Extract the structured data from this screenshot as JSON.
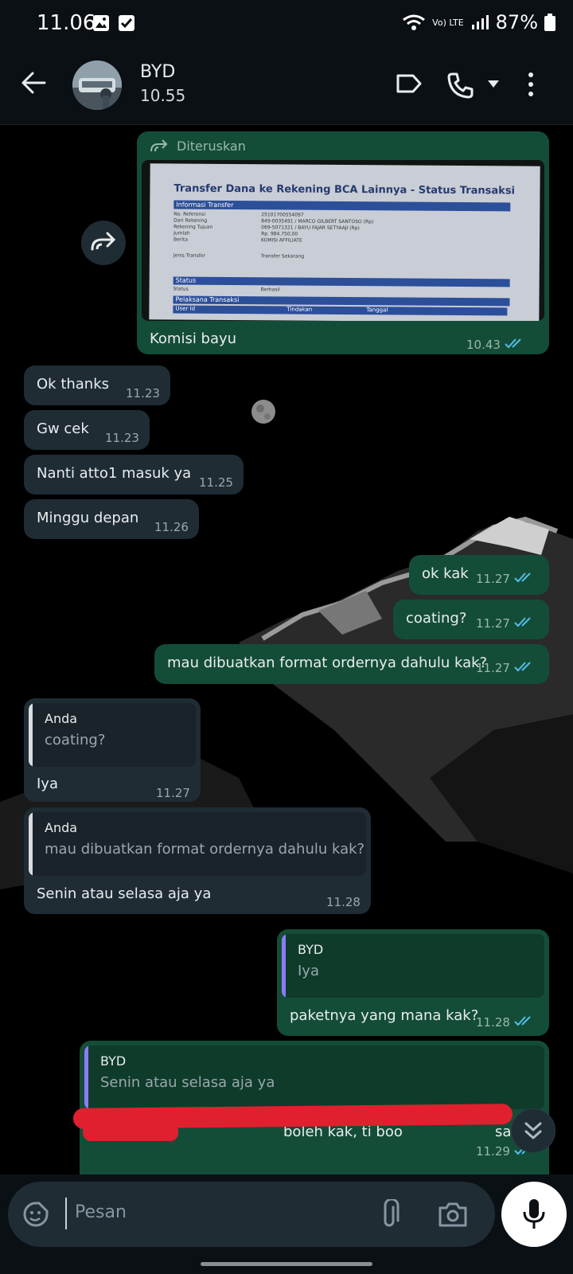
{
  "status_bar": {
    "time": "11.06",
    "battery": "87%",
    "network": "Vo) LTE"
  },
  "header": {
    "name": "BYD",
    "subtitle": "10.55"
  },
  "messages": {
    "forwarded": {
      "label": "Diteruskan",
      "caption": "Komisi bayu",
      "time": "10.43",
      "doc_title": "Transfer Dana ke Rekening BCA Lainnya - Status Transaksi",
      "doc_section1": "Informasi Transfer",
      "doc_rows": [
        {
          "k": "No. Referensi",
          "v": "25101700554097"
        },
        {
          "k": "Dari Rekening",
          "v": "849-0035491 / MARCO GILBERT SANTOSO (Rp)"
        },
        {
          "k": "Rekening Tujuan",
          "v": "069-5071321 / BAYU FAJAR SETYAAJI (Rp)"
        },
        {
          "k": "Jumlah",
          "v": "Rp. 984.750,00"
        },
        {
          "k": "Berita",
          "v": "KOMISI AFFILIATE"
        },
        {
          "k": "Jenis Transfer",
          "v": "Transfer Sekarang"
        }
      ],
      "doc_section2": "Status",
      "doc_status_k": "Status",
      "doc_status_v": "Berhasil",
      "doc_section3": "Pelaksana Transaksi",
      "doc_cols": [
        "User Id",
        "Tindakan",
        "Tanggal"
      ]
    },
    "m1": {
      "text": "Ok thanks",
      "time": "11.23"
    },
    "m2": {
      "text": "Gw cek",
      "time": "11.23"
    },
    "m3": {
      "text": "Nanti atto1 masuk ya",
      "time": "11.25"
    },
    "m4": {
      "text": "Minggu depan",
      "time": "11.26"
    },
    "o1": {
      "text": "ok kak",
      "time": "11.27"
    },
    "o2": {
      "text": "coating?",
      "time": "11.27"
    },
    "o3": {
      "text": "mau dibuatkan format ordernya dahulu kak?",
      "time": "11.27"
    },
    "r1": {
      "quote_name": "Anda",
      "quote_text": "coating?",
      "text": "Iya",
      "time": "11.27"
    },
    "r2": {
      "quote_name": "Anda",
      "quote_text": "mau dibuatkan format ordernya dahulu kak?",
      "text": "Senin atau selasa aja ya",
      "time": "11.28"
    },
    "o4": {
      "quote_name": "BYD",
      "quote_text": "Iya",
      "text": "paketnya yang mana kak?",
      "time": "11.28"
    },
    "o5": {
      "quote_name": "BYD",
      "quote_text": "Senin atau selasa aja ya",
      "text_visible": "boleh kak, ti boo",
      "text_end": "sa",
      "time": "11.29"
    }
  },
  "input": {
    "placeholder": "Pesan"
  },
  "colors": {
    "incoming": "#1f2c34",
    "outgoing": "#144d37",
    "read_ticks": "#53bdeb",
    "redaction": "#e0202e"
  }
}
